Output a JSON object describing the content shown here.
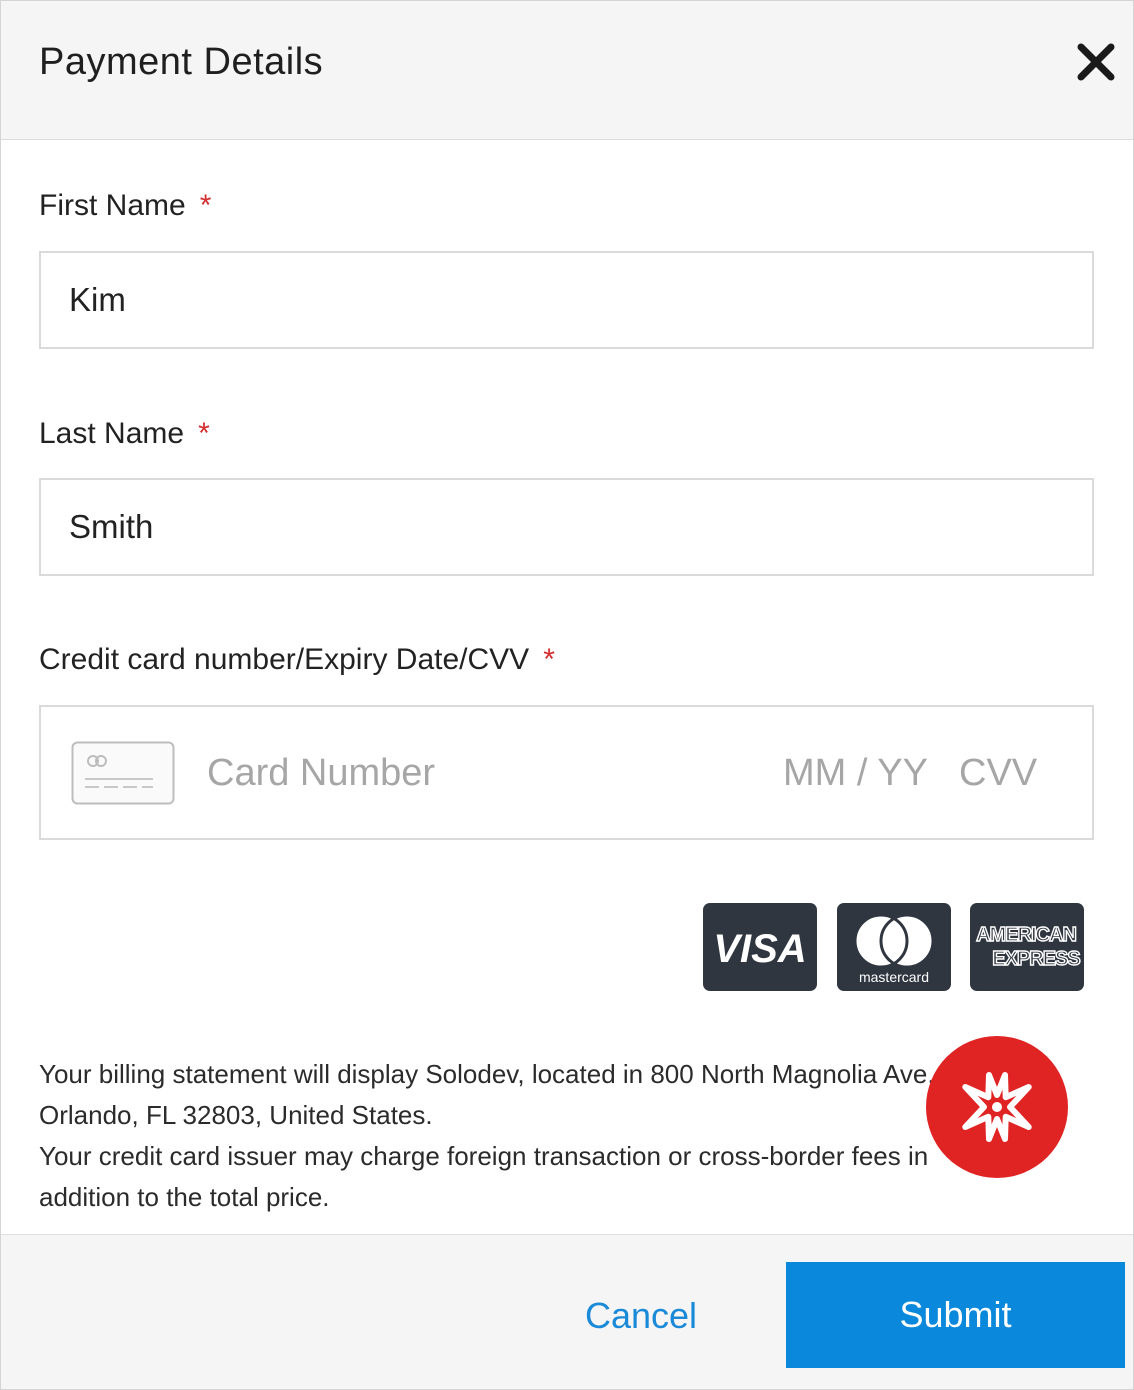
{
  "dialog": {
    "title": "Payment Details",
    "close_icon": "close-icon"
  },
  "form": {
    "first_name": {
      "label": "First Name",
      "required_mark": "*",
      "value": "Kim"
    },
    "last_name": {
      "label": "Last Name",
      "required_mark": "*",
      "value": "Smith"
    },
    "card": {
      "label": "Credit card number/Expiry Date/CVV",
      "required_mark": "*",
      "card_icon": "credit-card-icon",
      "number_placeholder": "Card Number",
      "expiry_placeholder": "MM / YY",
      "cvv_placeholder": "CVV"
    }
  },
  "brands": {
    "visa": "VISA",
    "mastercard": "mastercard",
    "amex_line1": "AMERICAN",
    "amex_line2": "EXPRESS"
  },
  "info": {
    "line1": "Your billing statement will display Solodev, located in 800 North Magnolia Ave.",
    "line2": "Orlando, FL 32803, United States.",
    "line3": "Your credit card issuer may charge foreign transaction or cross-border fees in",
    "line4": "addition to the total price."
  },
  "badge_icon": "star-burst-icon",
  "footer": {
    "cancel_label": "Cancel",
    "submit_label": "Submit"
  },
  "colors": {
    "accent": "#0a88dc",
    "link": "#1a8ad8",
    "required": "#d32f2f",
    "brand_card_bg": "#2f3640",
    "badge": "#e02424"
  }
}
